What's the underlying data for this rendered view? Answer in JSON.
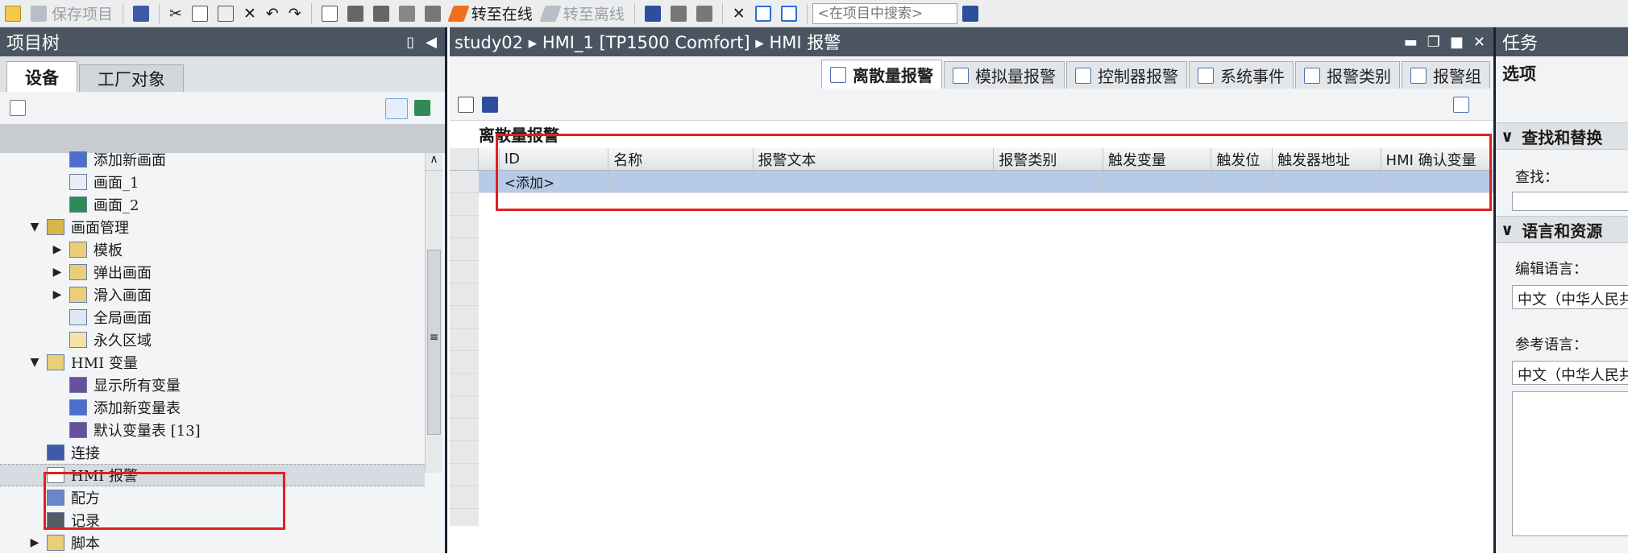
{
  "toolbar": {
    "save_project": "保存项目",
    "go_online": "转至在线",
    "go_offline": "转至离线",
    "search_placeholder": "<在项目中搜索>"
  },
  "left_panel": {
    "title": "项目树",
    "tabs": [
      "设备",
      "工厂对象"
    ],
    "tree": [
      {
        "label": "添加新画面",
        "indent": 2,
        "arrow": "",
        "icon": "add-screen-icon"
      },
      {
        "label": "画面_1",
        "indent": 2,
        "arrow": "",
        "icon": "screen-icon"
      },
      {
        "label": "画面_2",
        "indent": 2,
        "arrow": "",
        "icon": "start-screen-icon"
      },
      {
        "label": "画面管理",
        "indent": 1,
        "arrow": "▼",
        "icon": "screen-management-icon"
      },
      {
        "label": "模板",
        "indent": 2,
        "arrow": "▶",
        "icon": "folder-icon"
      },
      {
        "label": "弹出画面",
        "indent": 2,
        "arrow": "▶",
        "icon": "folder-icon"
      },
      {
        "label": "滑入画面",
        "indent": 2,
        "arrow": "▶",
        "icon": "folder-icon"
      },
      {
        "label": "全局画面",
        "indent": 2,
        "arrow": "",
        "icon": "global-screen-icon"
      },
      {
        "label": "永久区域",
        "indent": 2,
        "arrow": "",
        "icon": "permanent-area-icon"
      },
      {
        "label": "HMI 变量",
        "indent": 1,
        "arrow": "▼",
        "icon": "hmi-tags-folder-icon"
      },
      {
        "label": "显示所有变量",
        "indent": 2,
        "arrow": "",
        "icon": "show-all-tags-icon"
      },
      {
        "label": "添加新变量表",
        "indent": 2,
        "arrow": "",
        "icon": "add-tag-table-icon"
      },
      {
        "label": "默认变量表 [13]",
        "indent": 2,
        "arrow": "",
        "icon": "tag-table-icon"
      },
      {
        "label": "连接",
        "indent": 1,
        "arrow": "",
        "icon": "connection-icon"
      },
      {
        "label": "HMI 报警",
        "indent": 1,
        "arrow": "",
        "icon": "hmi-alarm-icon",
        "selected": true
      },
      {
        "label": "配方",
        "indent": 1,
        "arrow": "",
        "icon": "recipe-icon"
      },
      {
        "label": "记录",
        "indent": 1,
        "arrow": "",
        "icon": "log-icon"
      },
      {
        "label": "脚本",
        "indent": 1,
        "arrow": "▶",
        "icon": "script-icon"
      }
    ]
  },
  "center": {
    "breadcrumb": [
      "study02",
      "HMI_1 [TP1500 Comfort]",
      "HMI 报警"
    ],
    "tabs": [
      "离散量报警",
      "模拟量报警",
      "控制器报警",
      "系统事件",
      "报警类别",
      "报警组"
    ],
    "active_tab": 0,
    "section_title": "离散量报警",
    "table": {
      "columns": [
        "ID",
        "名称",
        "报警文本",
        "报警类别",
        "触发变量",
        "触发位",
        "触发器地址",
        "HMI 确认变量"
      ],
      "add_row": "<添加>"
    }
  },
  "right_panel": {
    "title": "任务",
    "options": "选项",
    "find_replace": "查找和替换",
    "find_label": "查找：",
    "lang_resources": "语言和资源",
    "edit_lang_label": "编辑语言：",
    "edit_lang_value": "中文（中华人民共和国）",
    "ref_lang_label": "参考语言：",
    "ref_lang_value": "中文（中华人民共和国）"
  },
  "colors": {
    "header_bg": "#4b5562",
    "highlight_red": "#e02020",
    "selected_row": "#b7cbe8"
  }
}
